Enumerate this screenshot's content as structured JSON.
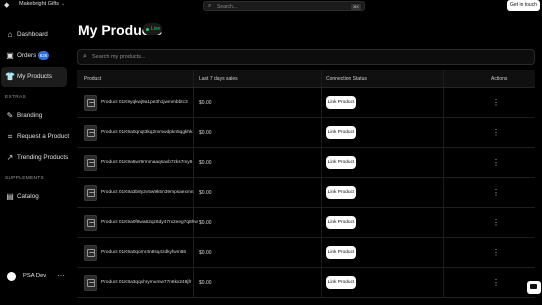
{
  "topbar": {
    "store_name": "Makebright Gifts",
    "search_placeholder": "Search...",
    "search_shortcut": "⌘K",
    "get_in_touch_label": "Get in touch"
  },
  "sidebar": {
    "items": [
      {
        "label": "Dashboard",
        "icon": "home-icon"
      },
      {
        "label": "Orders",
        "icon": "box-icon",
        "badge": "626"
      },
      {
        "label": "My Products",
        "icon": "shirt-icon",
        "active": true
      }
    ],
    "extras_label": "EXTRAS",
    "extras": [
      {
        "label": "Branding",
        "icon": "brush-icon"
      },
      {
        "label": "Request a Product",
        "icon": "tag-icon"
      },
      {
        "label": "Trending Products",
        "icon": "trend-icon"
      }
    ],
    "supplements_label": "SUPPLEMENTS",
    "supplements": [
      {
        "label": "Catalog",
        "icon": "book-icon"
      }
    ],
    "user": {
      "name": "PSA Dev"
    }
  },
  "main": {
    "title": "My Products",
    "live_label": "Live",
    "search_placeholder": "Search my products...",
    "columns": [
      "Product",
      "Last 7 days sales",
      "Connection Status",
      "Actions"
    ],
    "rows": [
      {
        "name": "Product 01K9yqkwj9a1pe3h1jwmmbbtc3",
        "sales": "$0.00",
        "action": "Link Product"
      },
      {
        "name": "Product 01K9a0qnqt3kq2mmwdpkn5qgkhk",
        "sales": "$0.00",
        "action": "Link Product"
      },
      {
        "name": "Product 01K9a6wr9rmmaaqsaxb7zks7my6",
        "sales": "$0.00",
        "action": "Link Product"
      },
      {
        "name": "Product 01K9a3b8y2v5w9k5n39mpsaexmn",
        "sales": "$0.00",
        "action": "Link Product"
      },
      {
        "name": "Product 01K9a0f8wa62qz8dy47rx2eeg7q8hw",
        "sales": "$0.00",
        "action": "Link Product"
      },
      {
        "name": "Product 01K9a0qomr4n8sq4zdkyfwmtt6",
        "sales": "$0.00",
        "action": "Link Product"
      },
      {
        "name": "Product 01K9a3qqxhrymumw77n6kx248jfr",
        "sales": "$0.00",
        "action": "Link Product"
      }
    ]
  }
}
